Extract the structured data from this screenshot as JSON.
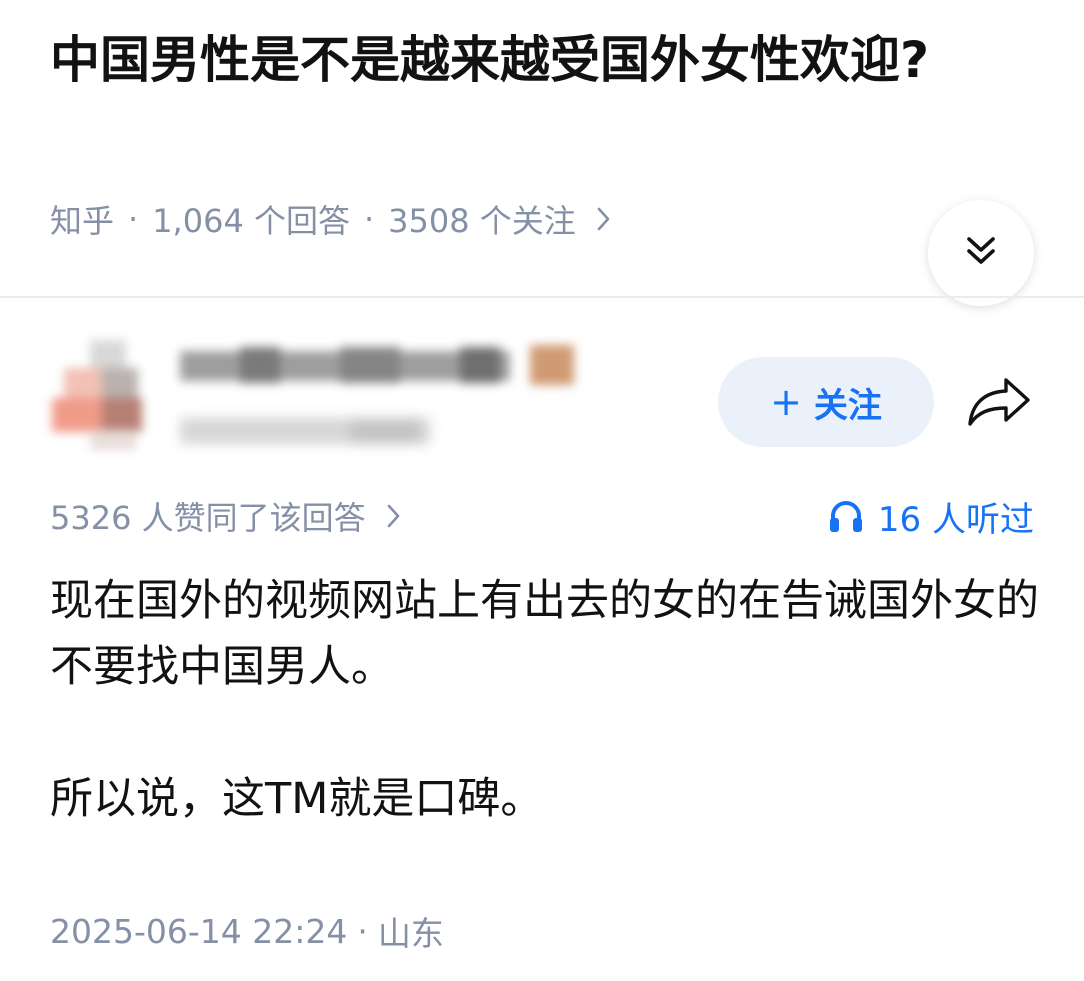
{
  "question": {
    "title": "中国男性是不是越来越受国外女性欢迎?",
    "source": "知乎",
    "separator": "·",
    "answer_count": "1,064 个回答",
    "follower_count": "3508 个关注"
  },
  "author": {
    "follow_label": "关注",
    "follow_plus": "+"
  },
  "answer": {
    "upvote_text": "5326 人赞同了该回答",
    "listen_text": "16 人听过",
    "paragraphs": [
      "现在国外的视频网站上有出去的女的在告诫国外女的不要找中国男人。",
      "所以说，这TM就是口碑。"
    ],
    "date": "2025-06-14 22:24",
    "location": "山东"
  },
  "colors": {
    "accent": "#1772f6",
    "meta_gray": "#8590a6",
    "follow_bg": "#ebf1fb",
    "text": "#121212"
  },
  "icons": [
    "chevron-right-icon",
    "double-chevron-down-icon",
    "share-arrow-icon",
    "headphones-icon"
  ]
}
